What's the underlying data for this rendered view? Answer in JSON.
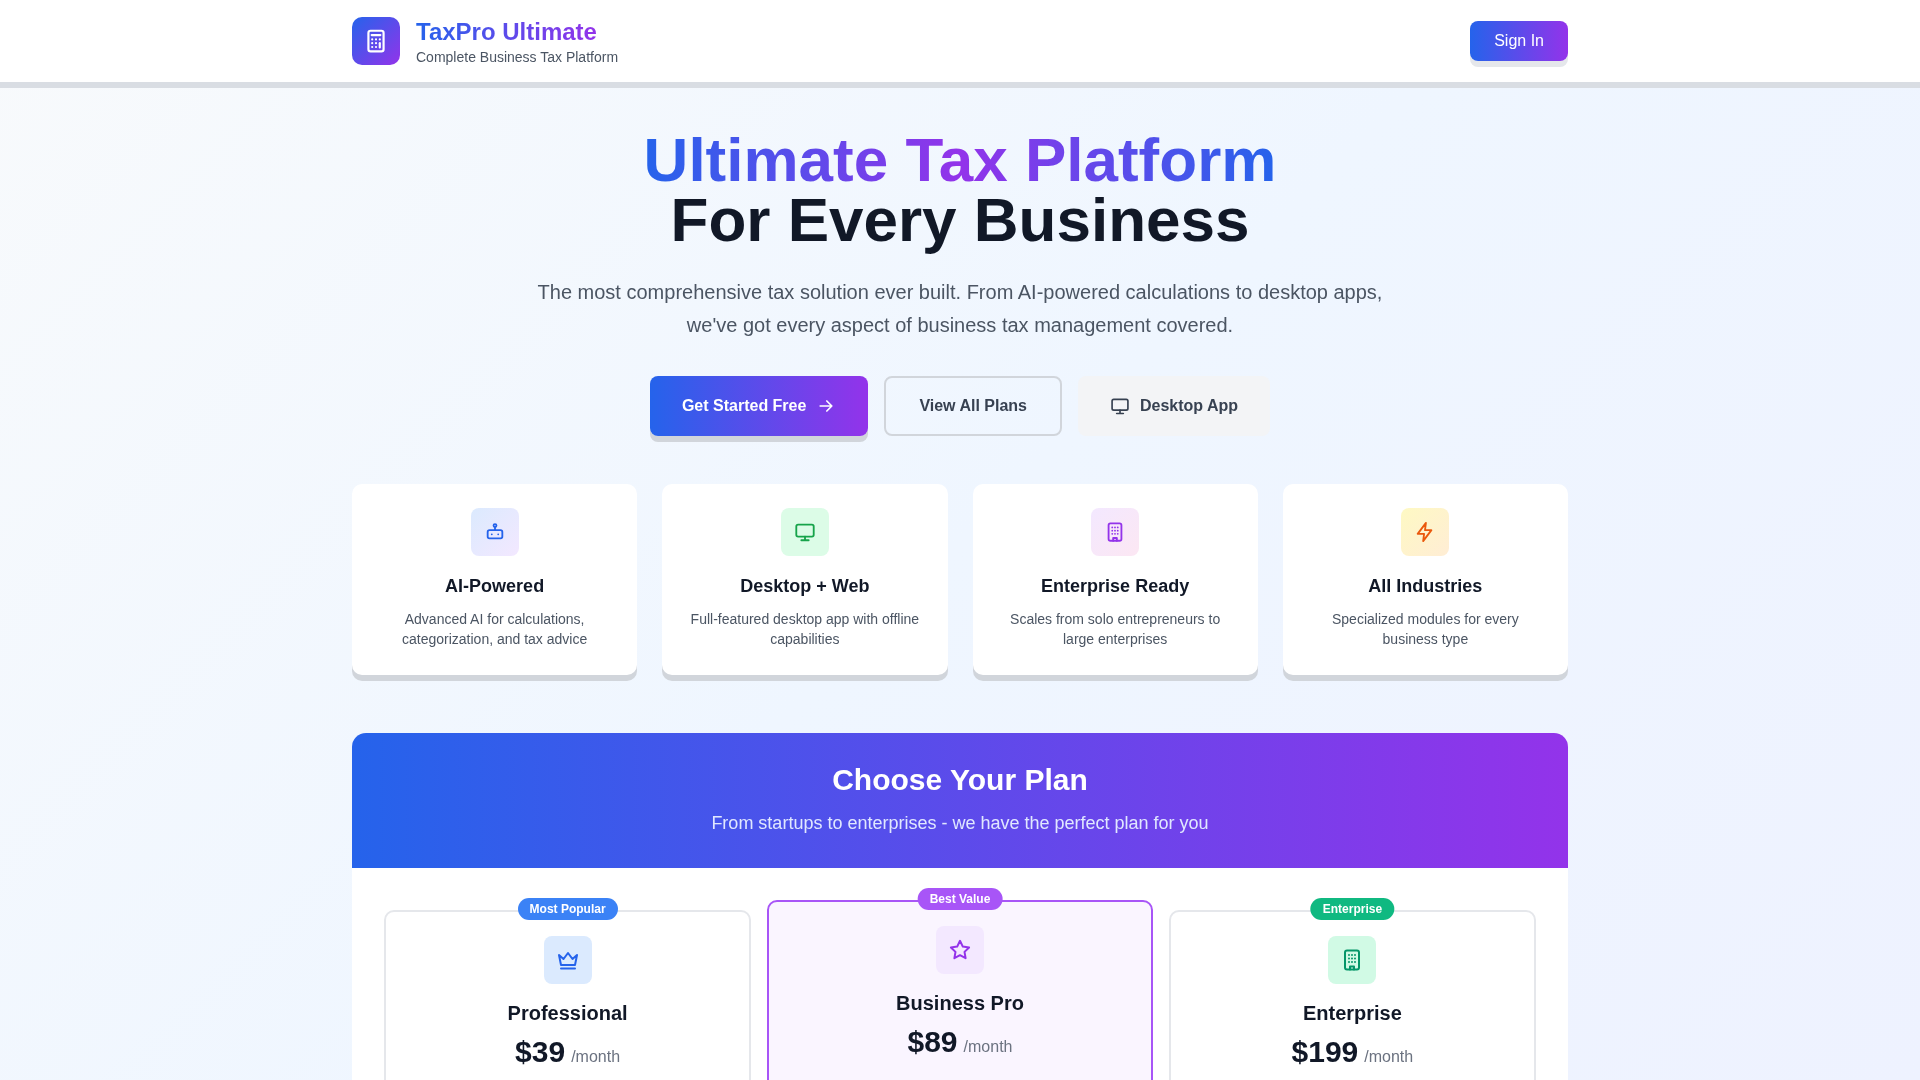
{
  "header": {
    "app_name": "TaxPro Ultimate",
    "tagline": "Complete Business Tax Platform",
    "sign_in": "Sign In"
  },
  "hero": {
    "title_line_1": "Ultimate Tax Platform",
    "title_line_2": "For Every Business",
    "subtitle": "The most comprehensive tax solution ever built. From AI-powered calculations to desktop apps, we've got every aspect of business tax management covered.",
    "buttons": [
      {
        "kind": "primary",
        "label": "Get Started Free"
      },
      {
        "kind": "outline",
        "label": "View All Plans"
      },
      {
        "kind": "desktop",
        "label": "Desktop App"
      }
    ]
  },
  "features": [
    {
      "kind": "robot",
      "title": "AI-Powered",
      "description": "Advanced AI for calculations, categorization, and tax advice"
    },
    {
      "kind": "monitor",
      "title": "Desktop + Web",
      "description": "Full-featured desktop app with offline capabilities"
    },
    {
      "kind": "building",
      "title": "Enterprise Ready",
      "description": "Scales from solo entrepreneurs to large enterprises"
    },
    {
      "kind": "bolt",
      "title": "All Industries",
      "description": "Specialized modules for every business type"
    }
  ],
  "plans_section": {
    "title": "Choose Your Plan",
    "subtitle": "From startups to enterprises - we have the perfect plan for you",
    "plans": [
      {
        "badge": "Most Popular",
        "color": "#3b82f6",
        "kind": "crown",
        "name": "Professional",
        "price": "$39",
        "period": "/month",
        "selected": false
      },
      {
        "badge": "Best Value",
        "color": "#a855f7",
        "kind": "star",
        "name": "Business Pro",
        "price": "$89",
        "period": "/month",
        "selected": true
      },
      {
        "badge": "Enterprise",
        "color": "#10b981",
        "kind": "building",
        "name": "Enterprise",
        "price": "$199",
        "period": "/month",
        "selected": false
      }
    ]
  }
}
